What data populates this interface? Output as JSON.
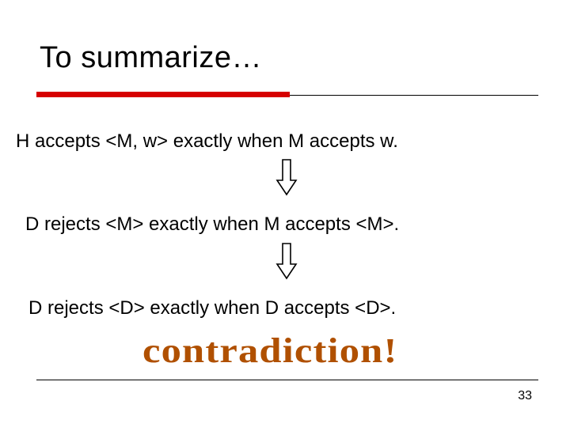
{
  "title": "To summarize…",
  "statements": [
    "H accepts <M, w> exactly when M accepts w.",
    "D rejects <M> exactly when M accepts <M>.",
    "D rejects <D> exactly when D accepts <D>."
  ],
  "exclaim": "contradiction!",
  "page_number": "33",
  "icons": {
    "down_arrow": "down-arrow-icon"
  },
  "colors": {
    "title_underline": "#d60000",
    "contradiction_text": "#b05000"
  }
}
